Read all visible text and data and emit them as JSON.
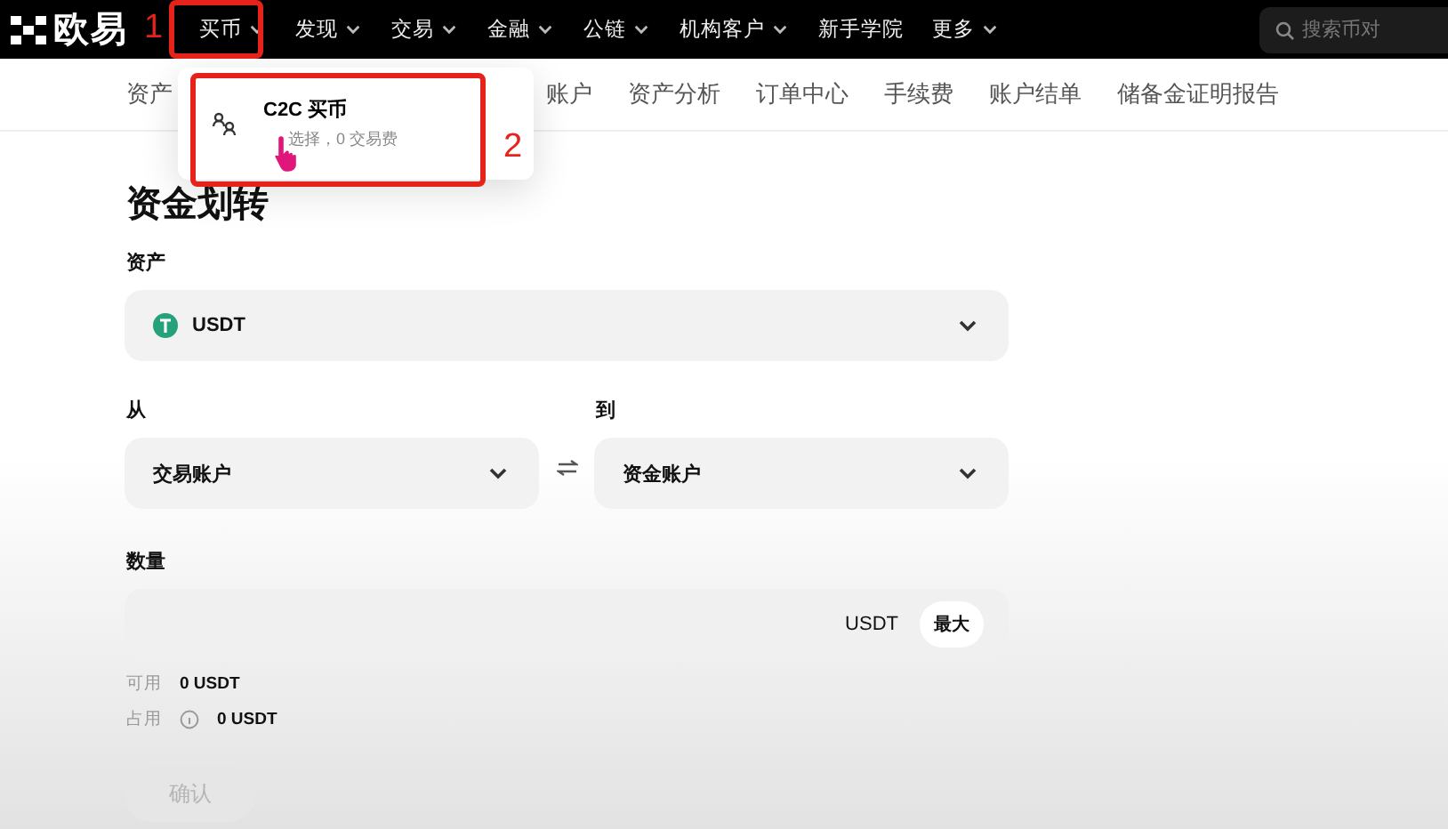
{
  "top_bar": {
    "logo": "欧易",
    "nav": [
      {
        "label": "买币",
        "has_menu": true
      },
      {
        "label": "发现",
        "has_menu": true
      },
      {
        "label": "交易",
        "has_menu": true
      },
      {
        "label": "金融",
        "has_menu": true
      },
      {
        "label": "公链",
        "has_menu": true
      },
      {
        "label": "机构客户",
        "has_menu": true
      },
      {
        "label": "新手学院",
        "has_menu": false
      },
      {
        "label": "更多",
        "has_menu": true
      }
    ],
    "search": {
      "placeholder": "搜索币对"
    }
  },
  "sub_nav": [
    "资产",
    "账户",
    "资产分析",
    "订单中心",
    "手续费",
    "账户结单",
    "储备金证明报告"
  ],
  "dropdown": {
    "items": [
      {
        "title": "C2C 买币",
        "subtitle": "选择，0 交易费"
      }
    ]
  },
  "annotations": [
    {
      "number": "1"
    },
    {
      "number": "2"
    }
  ],
  "transfer": {
    "title": "资金划转",
    "asset_label": "资产",
    "asset": "USDT",
    "from_label": "从",
    "from": "交易账户",
    "to_label": "到",
    "to": "资金账户",
    "amount_label": "数量",
    "amount_unit": "USDT",
    "max_button": "最大",
    "available_label": "可用",
    "available": "0 USDT",
    "occupied_label": "占用",
    "occupied": "0 USDT",
    "confirm": {
      "label": "确认",
      "disabled": true
    }
  }
}
